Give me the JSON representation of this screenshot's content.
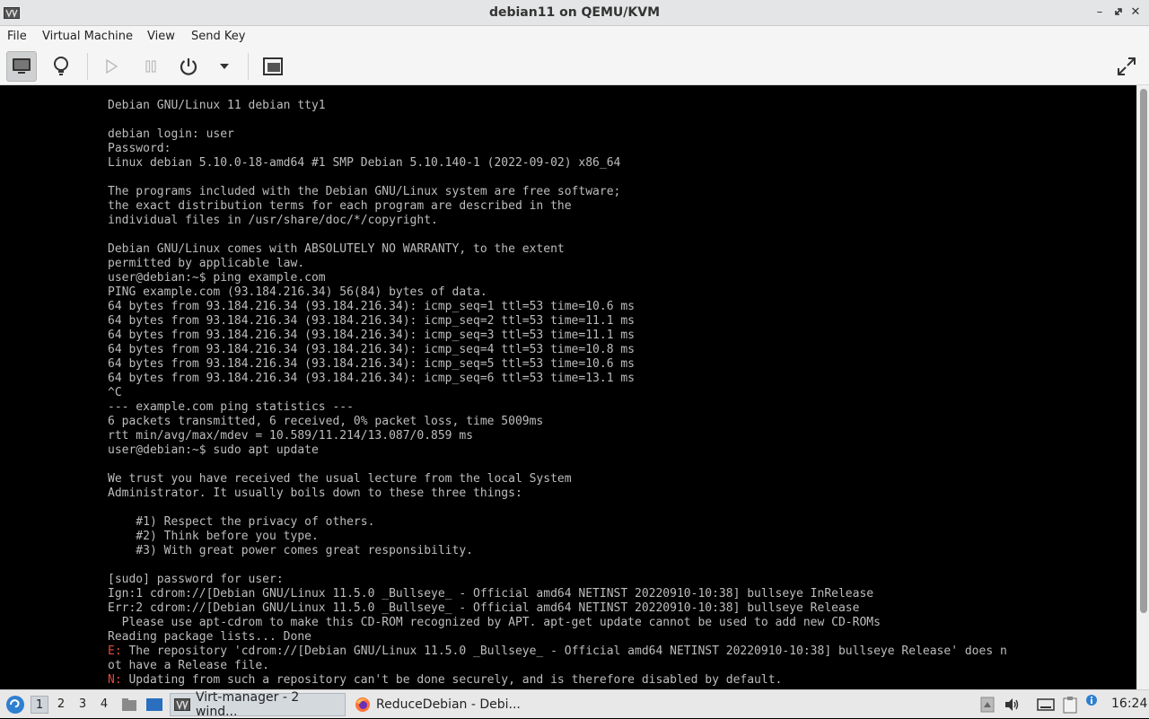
{
  "window": {
    "title": "debian11 on QEMU/KVM"
  },
  "menu": {
    "file": "File",
    "virtual_machine": "Virtual Machine",
    "view": "View",
    "send_key": "Send Key"
  },
  "toolbar": {
    "buttons": [
      "console-view",
      "details-view",
      "run",
      "pause",
      "power",
      "power-menu",
      "screenshot",
      "fullscreen"
    ],
    "active": "console-view"
  },
  "console": {
    "lines_before_err1": "Debian GNU/Linux 11 debian tty1\n\ndebian login: user\nPassword:\nLinux debian 5.10.0-18-amd64 #1 SMP Debian 5.10.140-1 (2022-09-02) x86_64\n\nThe programs included with the Debian GNU/Linux system are free software;\nthe exact distribution terms for each program are described in the\nindividual files in /usr/share/doc/*/copyright.\n\nDebian GNU/Linux comes with ABSOLUTELY NO WARRANTY, to the extent\npermitted by applicable law.\nuser@debian:~$ ping example.com\nPING example.com (93.184.216.34) 56(84) bytes of data.\n64 bytes from 93.184.216.34 (93.184.216.34): icmp_seq=1 ttl=53 time=10.6 ms\n64 bytes from 93.184.216.34 (93.184.216.34): icmp_seq=2 ttl=53 time=11.1 ms\n64 bytes from 93.184.216.34 (93.184.216.34): icmp_seq=3 ttl=53 time=11.1 ms\n64 bytes from 93.184.216.34 (93.184.216.34): icmp_seq=4 ttl=53 time=10.8 ms\n64 bytes from 93.184.216.34 (93.184.216.34): icmp_seq=5 ttl=53 time=10.6 ms\n64 bytes from 93.184.216.34 (93.184.216.34): icmp_seq=6 ttl=53 time=13.1 ms\n^C\n--- example.com ping statistics ---\n6 packets transmitted, 6 received, 0% packet loss, time 5009ms\nrtt min/avg/max/mdev = 10.589/11.214/13.087/0.859 ms\nuser@debian:~$ sudo apt update\n\nWe trust you have received the usual lecture from the local System\nAdministrator. It usually boils down to these three things:\n\n    #1) Respect the privacy of others.\n    #2) Think before you type.\n    #3) With great power comes great responsibility.\n\n[sudo] password for user:\nIgn:1 cdrom://[Debian GNU/Linux 11.5.0 _Bullseye_ - Official amd64 NETINST 20220910-10:38] bullseye InRelease\nErr:2 cdrom://[Debian GNU/Linux 11.5.0 _Bullseye_ - Official amd64 NETINST 20220910-10:38] bullseye Release\n  Please use apt-cdrom to make this CD-ROM recognized by APT. apt-get update cannot be used to add new CD-ROMs\nReading package lists... Done\n",
    "err1_prefix": "E:",
    "err1_text": " The repository 'cdrom://[Debian GNU/Linux 11.5.0 _Bullseye_ - Official amd64 NETINST 20220910-10:38] bullseye Release' does n\not have a Release file.\n",
    "err2_prefix": "N:",
    "err2_text": " Updating from such a repository can't be done securely, and is therefore disabled by default."
  },
  "taskbar": {
    "workspaces": [
      "1",
      "2",
      "3",
      "4"
    ],
    "active_workspace": "1",
    "tasks": [
      {
        "label": "Virt-manager - 2 wind...",
        "icon": "virt-manager-icon"
      },
      {
        "label": "ReduceDebian - Debi...",
        "icon": "firefox-icon"
      }
    ],
    "clock": "16:24"
  }
}
